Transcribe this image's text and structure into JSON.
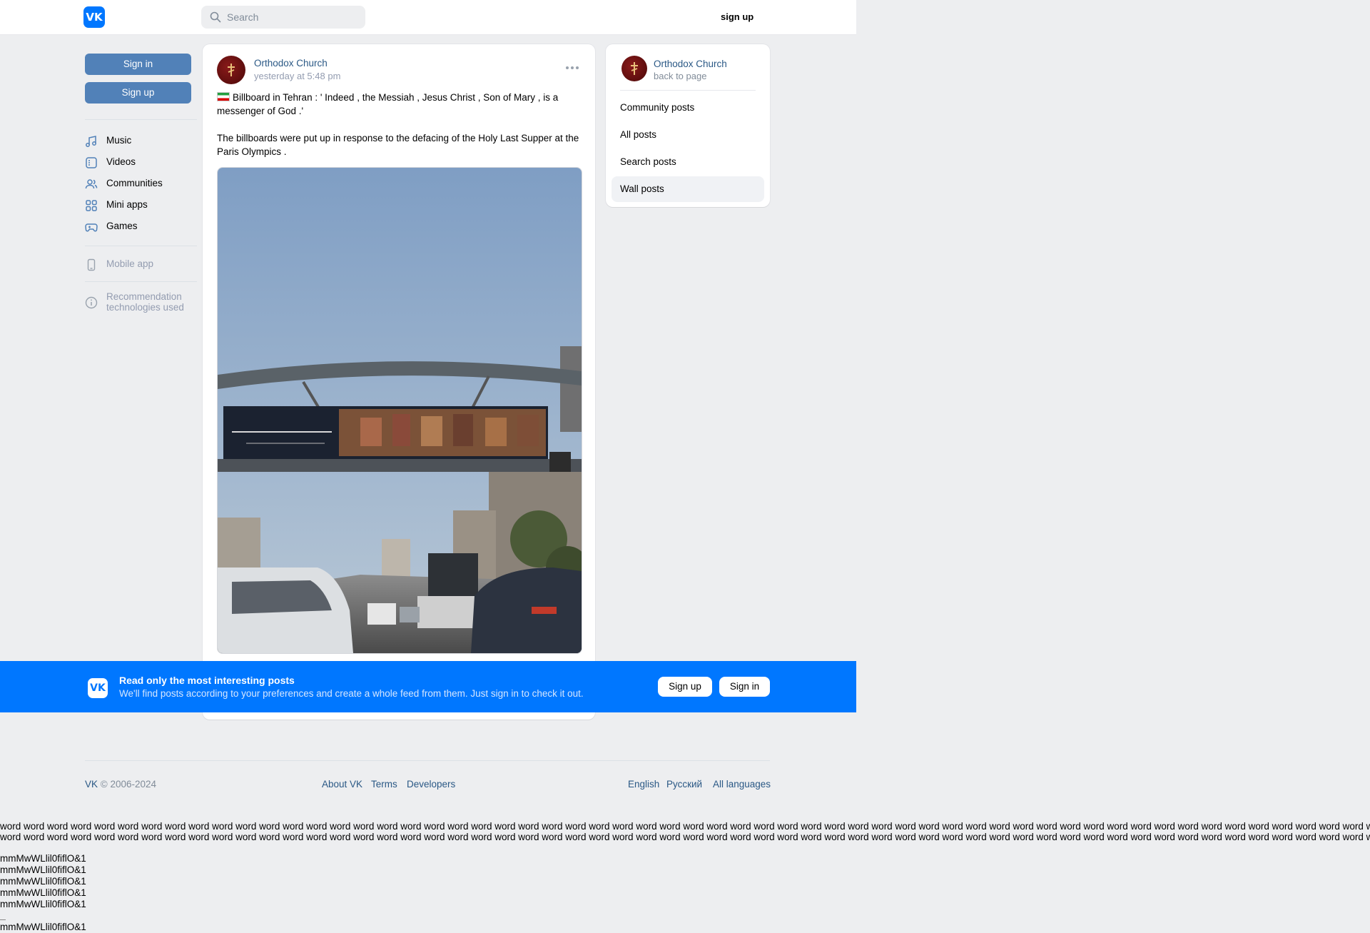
{
  "header": {
    "search_placeholder": "Search",
    "signup_link": "sign up"
  },
  "left_nav": {
    "sign_in": "Sign in",
    "sign_up": "Sign up",
    "items": [
      {
        "label": "Music",
        "icon": "music-note-icon"
      },
      {
        "label": "Videos",
        "icon": "video-icon"
      },
      {
        "label": "Communities",
        "icon": "users-icon"
      },
      {
        "label": "Mini apps",
        "icon": "apps-grid-icon"
      },
      {
        "label": "Games",
        "icon": "gamepad-icon"
      }
    ],
    "mobile_app": "Mobile app",
    "recommendation": "Recommendation technologies used"
  },
  "post": {
    "author": "Orthodox Church",
    "time": "yesterday at 5:48 pm",
    "text_1": "Billboard in Tehran : ' Indeed , the Messiah , Jesus Christ , Son of Mary , is a messenger of God .'",
    "text_2": "The billboards were put up in response to the defacing of the Holy Last Supper at the Paris Olympics ."
  },
  "right_sidebar": {
    "name": "Orthodox Church",
    "back": "back to page",
    "items": [
      "Community posts",
      "All posts",
      "Search posts",
      "Wall posts"
    ],
    "active": "Wall posts"
  },
  "banner": {
    "title": "Read only the most interesting posts",
    "subtitle": "We'll find posts according to your preferences and create a whole feed from them. Just sign in to check it out.",
    "sign_up": "Sign up",
    "sign_in": "Sign in"
  },
  "footer": {
    "copyright": "VK © 2006-2024",
    "links": [
      "About VK",
      "Terms",
      "Developers"
    ],
    "languages": [
      "English",
      "Русский",
      "All languages"
    ]
  },
  "filler": {
    "word_line": "word word word word word word word word word word word word word word word word word word word word word word word word word word word word word word word word word word word word word word word word word word word word word word word word word word word word word word word word word word word word",
    "glyph_line": "mmMwWLlil0fiflO&1"
  },
  "colors": {
    "brand": "#0077ff",
    "button": "#5181b8",
    "link": "#2a5885",
    "background": "#edeef0"
  }
}
